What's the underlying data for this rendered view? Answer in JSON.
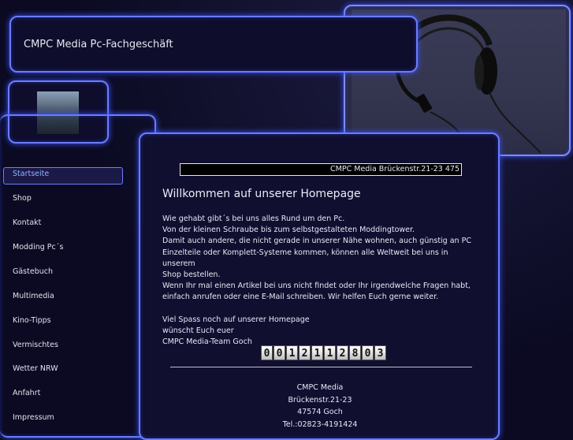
{
  "site": {
    "title": "CMPC Media Pc-Fachgeschäft"
  },
  "nav": {
    "items": [
      {
        "label": "Startseite",
        "active": true
      },
      {
        "label": "Shop"
      },
      {
        "label": "Kontakt"
      },
      {
        "label": "Modding Pc´s"
      },
      {
        "label": "Gästebuch"
      },
      {
        "label": "Multimedia"
      },
      {
        "label": "Kino-Tipps"
      },
      {
        "label": "Vermischtes"
      },
      {
        "label": "Wetter NRW"
      },
      {
        "label": "Anfahrt"
      },
      {
        "label": "Impressum"
      }
    ]
  },
  "content": {
    "address_bar": "CMPC Media Brückenstr.21-23 475",
    "heading": "Willkommen auf unserer Homepage",
    "lines": [
      "Wie gehabt gibt´s bei uns alles Rund um den Pc.",
      "Von der kleinen Schraube bis zum selbstgestalteten Moddingtower.",
      "Damit auch andere, die nicht gerade in unserer Nähe wohnen, auch günstig an PC",
      "Einzelteile oder Komplett-Systeme kommen, können alle Weltweit bei uns in unserem",
      "Shop bestellen.",
      "Wenn Ihr mal einen Artikel bei uns nicht findet oder Ihr irgendwelche Fragen habt,",
      "einfach anrufen oder eine E-Mail schreiben. Wir helfen Euch gerne weiter."
    ],
    "closing": [
      "Viel Spass noch auf unserer Homepage",
      "wünscht Euch euer",
      "CMPC Media-Team Goch"
    ],
    "counter_digits": [
      "0",
      "0",
      "1",
      "2",
      "1",
      "1",
      "2",
      "8",
      "0",
      "3"
    ]
  },
  "footer": {
    "lines": [
      "CMPC Media",
      "Brückenstr.21-23",
      "47574 Goch",
      "Tel.:02823-4191424"
    ]
  },
  "colors": {
    "accent": "#6b7cff",
    "background": "#0b0a22",
    "active_link": "#8fb7ff"
  }
}
